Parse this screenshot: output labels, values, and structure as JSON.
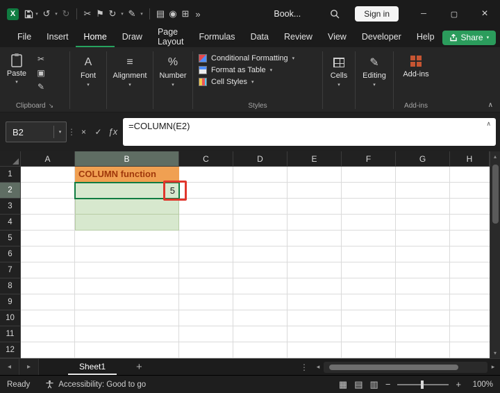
{
  "colors": {
    "accent_green": "#107C41",
    "share_green": "#2B9C5C",
    "b1_fill": "#F0A052",
    "b1_text_color": "#A0380B",
    "range_fill": "#D7E8CE",
    "annotation_red": "#E0362C",
    "addins_red": "#C65532"
  },
  "icons": {
    "excel_logo_letter": "X",
    "dropdown": "▾",
    "undo": "↺",
    "redo": "↻",
    "cut": "✂",
    "flag": "⚑",
    "refresh": "↻",
    "pen": "✎",
    "doc": "▤",
    "camera": "◉",
    "grid": "⊞",
    "more": "»",
    "minimize": "─",
    "maximize": "▢",
    "close": "×",
    "dots_vertical": "⋮",
    "cancel": "×",
    "enter": "✓",
    "fx": "ƒx",
    "copy": "▣",
    "format_painter": "✎",
    "font_glyph": "A",
    "alignment_glyph": "≡",
    "percent": "%",
    "collapse_ribbon": "∧",
    "expand_formula": "∧",
    "dialog_launcher": "↘",
    "nav_left": "◂",
    "nav_right": "▸",
    "scroll_up": "▴",
    "scroll_down": "▾",
    "view_normal": "▦",
    "view_page_layout": "▤",
    "view_page_break": "▥"
  },
  "titlebar": {
    "document_name": "Book...",
    "sign_in_label": "Sign in"
  },
  "menu": {
    "tabs": [
      "File",
      "Insert",
      "Home",
      "Draw",
      "Page Layout",
      "Formulas",
      "Data",
      "Review",
      "View",
      "Developer",
      "Help"
    ],
    "active_tab": "Home",
    "share_label": "Share"
  },
  "ribbon": {
    "paste_label": "Paste",
    "clipboard_group_label": "Clipboard",
    "font_label": "Font",
    "alignment_label": "Alignment",
    "number_label": "Number",
    "styles_items": [
      "Conditional Formatting",
      "Format as Table",
      "Cell Styles"
    ],
    "styles_group_label": "Styles",
    "cells_label": "Cells",
    "editing_label": "Editing",
    "addins_label": "Add-ins",
    "addins_group_label": "Add-ins"
  },
  "formula_bar": {
    "name_box_value": "B2",
    "formula": "=COLUMN(E2)"
  },
  "grid": {
    "column_headers": [
      "A",
      "B",
      "C",
      "D",
      "E",
      "F",
      "G",
      "H"
    ],
    "row_headers": [
      "1",
      "2",
      "3",
      "4",
      "5",
      "6",
      "7",
      "8",
      "9",
      "10",
      "11",
      "12"
    ],
    "selected_column": "B",
    "selected_row": "2",
    "b1_text": "COLUMN function",
    "b2_value": "5"
  },
  "sheet_bar": {
    "active_sheet": "Sheet1",
    "add_sheet": "+"
  },
  "status_bar": {
    "mode": "Ready",
    "accessibility_text": "Accessibility: Good to go",
    "zoom_out": "−",
    "zoom_in": "+",
    "zoom_level": "100%"
  }
}
